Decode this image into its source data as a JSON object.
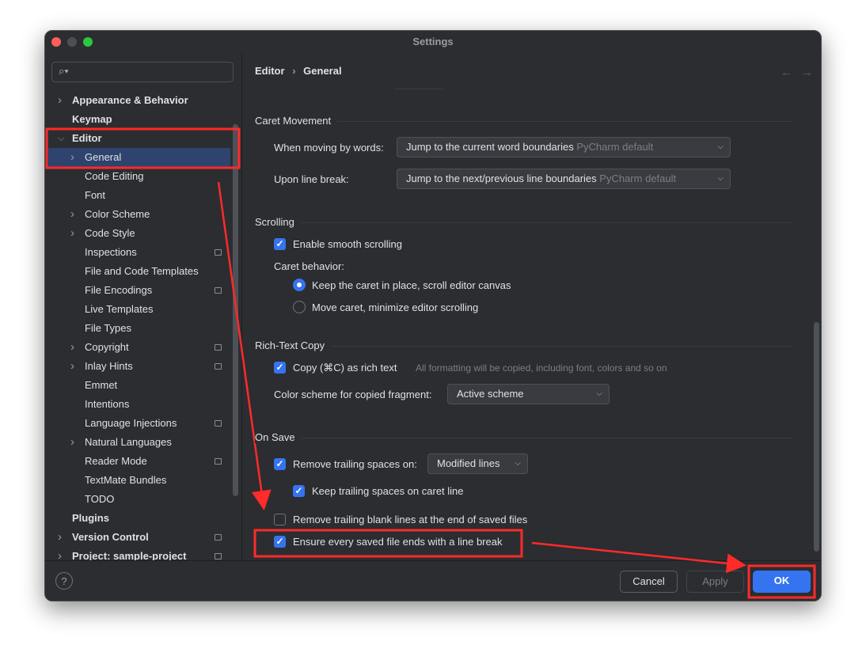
{
  "window": {
    "title": "Settings"
  },
  "search": {
    "placeholder": ""
  },
  "sidebar": {
    "items": [
      {
        "label": "Appearance & Behavior",
        "level": 0,
        "bold": true,
        "chevron": "right",
        "badge": false
      },
      {
        "label": "Keymap",
        "level": 0,
        "bold": true,
        "chevron": "",
        "badge": false
      },
      {
        "label": "Editor",
        "level": 0,
        "bold": true,
        "chevron": "down",
        "badge": false
      },
      {
        "label": "General",
        "level": 1,
        "bold": false,
        "chevron": "right",
        "badge": false,
        "selected": true
      },
      {
        "label": "Code Editing",
        "level": 1,
        "bold": false,
        "chevron": "",
        "badge": false
      },
      {
        "label": "Font",
        "level": 1,
        "bold": false,
        "chevron": "",
        "badge": false
      },
      {
        "label": "Color Scheme",
        "level": 1,
        "bold": false,
        "chevron": "right",
        "badge": false
      },
      {
        "label": "Code Style",
        "level": 1,
        "bold": false,
        "chevron": "right",
        "badge": false
      },
      {
        "label": "Inspections",
        "level": 1,
        "bold": false,
        "chevron": "",
        "badge": true
      },
      {
        "label": "File and Code Templates",
        "level": 1,
        "bold": false,
        "chevron": "",
        "badge": false
      },
      {
        "label": "File Encodings",
        "level": 1,
        "bold": false,
        "chevron": "",
        "badge": true
      },
      {
        "label": "Live Templates",
        "level": 1,
        "bold": false,
        "chevron": "",
        "badge": false
      },
      {
        "label": "File Types",
        "level": 1,
        "bold": false,
        "chevron": "",
        "badge": false
      },
      {
        "label": "Copyright",
        "level": 1,
        "bold": false,
        "chevron": "right",
        "badge": true
      },
      {
        "label": "Inlay Hints",
        "level": 1,
        "bold": false,
        "chevron": "right",
        "badge": true
      },
      {
        "label": "Emmet",
        "level": 1,
        "bold": false,
        "chevron": "",
        "badge": false
      },
      {
        "label": "Intentions",
        "level": 1,
        "bold": false,
        "chevron": "",
        "badge": false
      },
      {
        "label": "Language Injections",
        "level": 1,
        "bold": false,
        "chevron": "",
        "badge": true
      },
      {
        "label": "Natural Languages",
        "level": 1,
        "bold": false,
        "chevron": "right",
        "badge": false
      },
      {
        "label": "Reader Mode",
        "level": 1,
        "bold": false,
        "chevron": "",
        "badge": true
      },
      {
        "label": "TextMate Bundles",
        "level": 1,
        "bold": false,
        "chevron": "",
        "badge": false
      },
      {
        "label": "TODO",
        "level": 1,
        "bold": false,
        "chevron": "",
        "badge": false
      },
      {
        "label": "Plugins",
        "level": 0,
        "bold": true,
        "chevron": "",
        "badge": false
      },
      {
        "label": "Version Control",
        "level": 0,
        "bold": true,
        "chevron": "right",
        "badge": true
      },
      {
        "label": "Project: sample-project",
        "level": 0,
        "bold": true,
        "chevron": "right",
        "badge": true
      }
    ]
  },
  "breadcrumb": {
    "parent": "Editor",
    "sep": "›",
    "current": "General"
  },
  "nav": {
    "back": "←",
    "forward": "→"
  },
  "caret": {
    "title": "Caret Movement",
    "words_label": "When moving by words:",
    "words_value": "Jump to the current word boundaries",
    "words_hint": "PyCharm default",
    "break_label": "Upon line break:",
    "break_value": "Jump to the next/previous line boundaries",
    "break_hint": "PyCharm default"
  },
  "scrolling": {
    "title": "Scrolling",
    "smooth": "Enable smooth scrolling",
    "smooth_checked": true,
    "behavior_label": "Caret behavior:",
    "opt1": "Keep the caret in place, scroll editor canvas",
    "opt2": "Move caret, minimize editor scrolling",
    "selected": "opt1"
  },
  "rich": {
    "title": "Rich-Text Copy",
    "copy": "Copy (⌘C) as rich text",
    "copy_checked": true,
    "copy_hint": "All formatting will be copied, including font, colors and so on",
    "scheme_label": "Color scheme for copied fragment:",
    "scheme_value": "Active scheme"
  },
  "onsave": {
    "title": "On Save",
    "trailing": "Remove trailing spaces on:",
    "trailing_checked": true,
    "trailing_value": "Modified lines",
    "keep": "Keep trailing spaces on caret line",
    "keep_checked": true,
    "blank": "Remove trailing blank lines at the end of saved files",
    "blank_checked": false,
    "ensure": "Ensure every saved file ends with a line break",
    "ensure_checked": true
  },
  "footer": {
    "help": "?",
    "cancel": "Cancel",
    "apply": "Apply",
    "ok": "OK"
  },
  "colors": {
    "accent": "#3574f0",
    "selection": "#2e436e",
    "annotation": "#ff2a2a",
    "background": "#2b2d30"
  }
}
